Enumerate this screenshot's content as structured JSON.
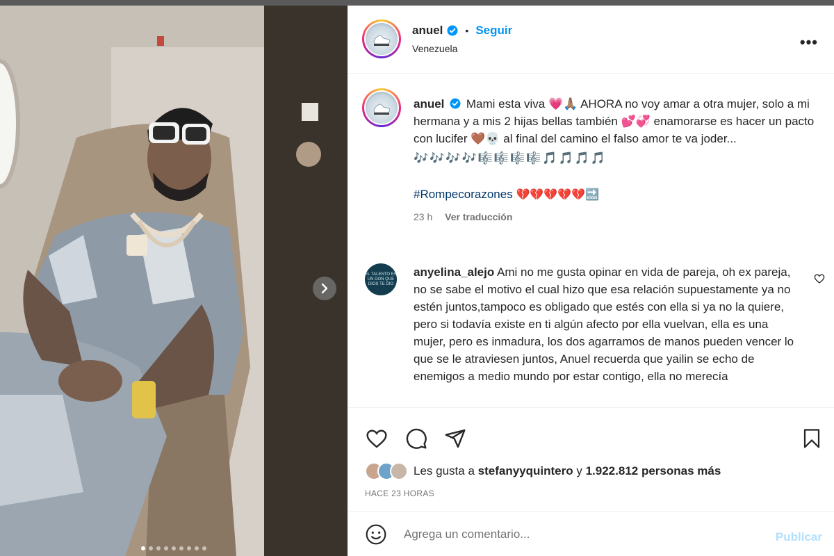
{
  "post": {
    "author": "anuel",
    "follow_label": "Seguir",
    "separator": "•",
    "location": "Venezuela",
    "more_label": "•••",
    "carousel_dots": 9,
    "carousel_active": 0
  },
  "caption": {
    "username": "anuel",
    "text": "Mami esta viva 💗🙏🏽 AHORA no voy amar a otra mujer, solo a mi hermana y a mis 2 hijas bellas también 💕💞 enamorarse es hacer un pacto con lucifer 🤎💀 al final del camino el falso amor te va joder...",
    "music_line": "🎶🎶🎶🎶🎼🎼🎼🎼🎵🎵🎵🎵",
    "hashtag": "#Rompecorazones",
    "hashtag_emojis": "💔💔💔💔💔🔜",
    "time_ago": "23 h",
    "translate_label": "Ver traducción"
  },
  "comment": {
    "username": "anyelina_alejo",
    "avatar_text": "EL TALENTO ES UN DON QUE DIOS TE DIO",
    "text": "Ami no me gusta opinar en vida de pareja, oh ex pareja, no se sabe el motivo el cual hizo que esa relación supuestamente ya no estén juntos,tampoco es obligado que estés con ella si ya no la quiere, pero si todavía existe en ti algún afecto por ella vuelvan, ella es una mujer, pero es inmadura, los dos agarramos de manos pueden vencer lo que se le atraviesen juntos, Anuel recuerda que yailin se echo de enemigos a medio mundo por estar contigo, ella no merecía"
  },
  "likes": {
    "prefix": "Les gusta a",
    "user": "stefanyyquintero",
    "connector": "y",
    "count": "1.922.812 personas más"
  },
  "timestamp": "HACE 23 HORAS",
  "composer": {
    "placeholder": "Agrega un comentario...",
    "publish_label": "Publicar"
  },
  "colors": {
    "accent": "#0095f6",
    "publish_disabled": "#b2dffc",
    "hashtag": "#00376b",
    "muted": "#737373"
  },
  "icons": {
    "like": "heart-icon",
    "comment": "comment-icon",
    "share": "send-icon",
    "save": "bookmark-icon",
    "emoji": "smiley-icon",
    "next": "chevron-right-icon"
  }
}
